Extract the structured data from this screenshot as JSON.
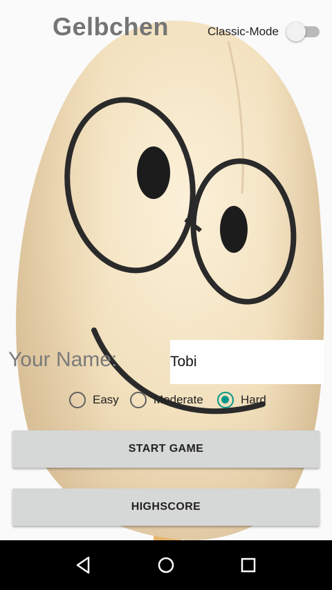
{
  "app": {
    "title": "Gelbchen"
  },
  "classic_mode": {
    "label": "Classic-Mode",
    "enabled": false
  },
  "name_field": {
    "label": "Your Name:",
    "value": "Tobi"
  },
  "difficulty": {
    "options": [
      "Easy",
      "Moderate",
      "Hard"
    ],
    "selected": "Hard",
    "accent_color": "#009688"
  },
  "buttons": {
    "start_label": "START GAME",
    "highscore_label": "HIGHSCORE"
  },
  "navigation_bar": {
    "icons": [
      "back-icon",
      "home-icon",
      "recents-icon"
    ]
  }
}
